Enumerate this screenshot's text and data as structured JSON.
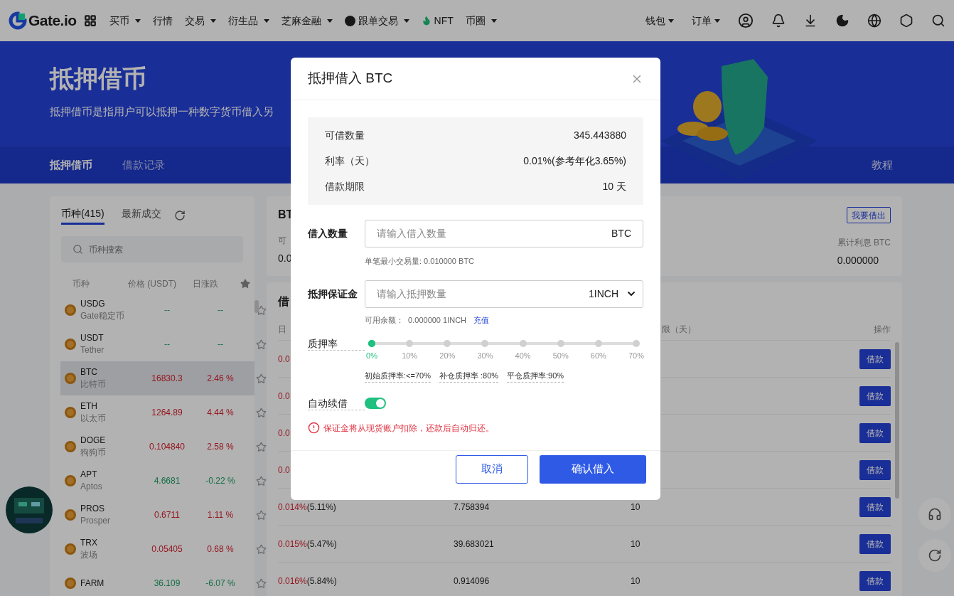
{
  "nav": {
    "brand": "Gate.io",
    "items": [
      {
        "label": "买币",
        "dropdown": true,
        "kind": "plain"
      },
      {
        "label": "行情",
        "dropdown": false,
        "kind": "plain"
      },
      {
        "label": "交易",
        "dropdown": true,
        "kind": "plain"
      },
      {
        "label": "衍生品",
        "dropdown": true,
        "kind": "plain"
      },
      {
        "label": "芝麻金融",
        "dropdown": true,
        "kind": "plain"
      },
      {
        "label": "跟单交易",
        "dropdown": true,
        "kind": "badge"
      },
      {
        "label": "NFT",
        "dropdown": false,
        "kind": "flame"
      },
      {
        "label": "币圈",
        "dropdown": true,
        "kind": "plain"
      }
    ],
    "right_items": [
      {
        "label": "钱包",
        "dropdown": true
      },
      {
        "label": "订单",
        "dropdown": true
      }
    ]
  },
  "banner": {
    "title": "抵押借币",
    "subtitle": "抵押借币是指用户可以抵押一种数字货币借入另",
    "tabs": [
      {
        "label": "抵押借币",
        "selected": true
      },
      {
        "label": "借款记录",
        "selected": false
      }
    ],
    "tutorial": "教程"
  },
  "coin_panel": {
    "tabs": [
      {
        "label": "币种(415)",
        "selected": true
      },
      {
        "label": "最新成交",
        "selected": false
      }
    ],
    "search": {
      "placeholder": "币种搜索"
    },
    "columns": [
      "币种",
      "价格 (USDT)",
      "日涨跌"
    ],
    "rows": [
      {
        "symbol": "USDG",
        "name": "Gate稳定币",
        "price": "--",
        "change": "--",
        "rising": false,
        "selected": false,
        "starred": false
      },
      {
        "symbol": "USDT",
        "name": "Tether",
        "price": "--",
        "change": "--",
        "rising": false,
        "selected": false,
        "starred": false
      },
      {
        "symbol": "BTC",
        "name": "比特币",
        "price": "16830.3",
        "change": "2.46 %",
        "rising": true,
        "selected": true,
        "starred": false
      },
      {
        "symbol": "ETH",
        "name": "以太币",
        "price": "1264.89",
        "change": "4.44 %",
        "rising": true,
        "selected": false,
        "starred": false
      },
      {
        "symbol": "DOGE",
        "name": "狗狗币",
        "price": "0.104840",
        "change": "2.58 %",
        "rising": true,
        "selected": false,
        "starred": false
      },
      {
        "symbol": "APT",
        "name": "Aptos",
        "price": "4.6681",
        "change": "-0.22 %",
        "rising": false,
        "selected": false,
        "starred": false
      },
      {
        "symbol": "PROS",
        "name": "Prosper",
        "price": "0.6711",
        "change": "1.11 %",
        "rising": true,
        "selected": false,
        "starred": false
      },
      {
        "symbol": "TRX",
        "name": "波场",
        "price": "0.05405",
        "change": "0.68 %",
        "rising": true,
        "selected": false,
        "starred": false
      },
      {
        "symbol": "FARM",
        "price": "36.109",
        "change": "-6.07 %",
        "rising": false,
        "selected": false,
        "starred": false
      }
    ]
  },
  "summary_card": {
    "title": "BT",
    "label": "可",
    "value": "0.0",
    "lend_button": "我要借出",
    "interest_label": "累计利息 BTC",
    "interest_value": "0.000000"
  },
  "loan_table": {
    "title": "借",
    "columns": [
      "日",
      "限（天）",
      "操作"
    ],
    "rows": [
      {
        "rate": "0.0",
        "button": "借款"
      },
      {
        "rate": "0.0",
        "button": "借款"
      },
      {
        "rate": "0.0",
        "button": "借款"
      },
      {
        "rate": "0.0",
        "button": "借款"
      },
      {
        "rate": "0.014%",
        "annual": "(5.11%)",
        "amount": "7.758394",
        "days": "10",
        "button": "借款"
      },
      {
        "rate": "0.015%",
        "annual": "(5.47%)",
        "amount": "39.683021",
        "days": "10",
        "button": "借款"
      },
      {
        "rate": "0.016%",
        "annual": "(5.84%)",
        "amount": "0.914096",
        "days": "10",
        "button": "借款"
      }
    ]
  },
  "modal": {
    "title": "抵押借入 BTC",
    "info": [
      {
        "label": "可借数量",
        "value": "345.443880"
      },
      {
        "label": "利率（天）",
        "value": "0.01%(参考年化3.65%)"
      },
      {
        "label": "借款期限",
        "value": "10 天"
      }
    ],
    "borrow": {
      "label": "借入数量",
      "placeholder": "请输入借入数量",
      "unit": "BTC",
      "hint": "单笔最小交易量: 0.010000 BTC"
    },
    "collateral": {
      "label": "抵押保证金",
      "placeholder": "请输入抵押数量",
      "currency": "1INCH",
      "hint": "可用余额：  0.000000 1INCH",
      "link": "充值"
    },
    "ratio": {
      "label": "质押率",
      "level": 0,
      "marks": [
        "0%",
        "10%",
        "20%",
        "30%",
        "40%",
        "50%",
        "60%",
        "70%"
      ],
      "notes": [
        "初始质押率:<=70%",
        "补仓质押率 :80%",
        "平仓质押率:90%"
      ]
    },
    "auto_renew": {
      "label": "自动续借",
      "on": true
    },
    "warning": "保证金将从现货账户扣除，还款后自动归还。",
    "buttons": [
      {
        "label": "取消",
        "kind": "secondary"
      },
      {
        "label": "确认借入",
        "kind": "primary"
      }
    ]
  }
}
